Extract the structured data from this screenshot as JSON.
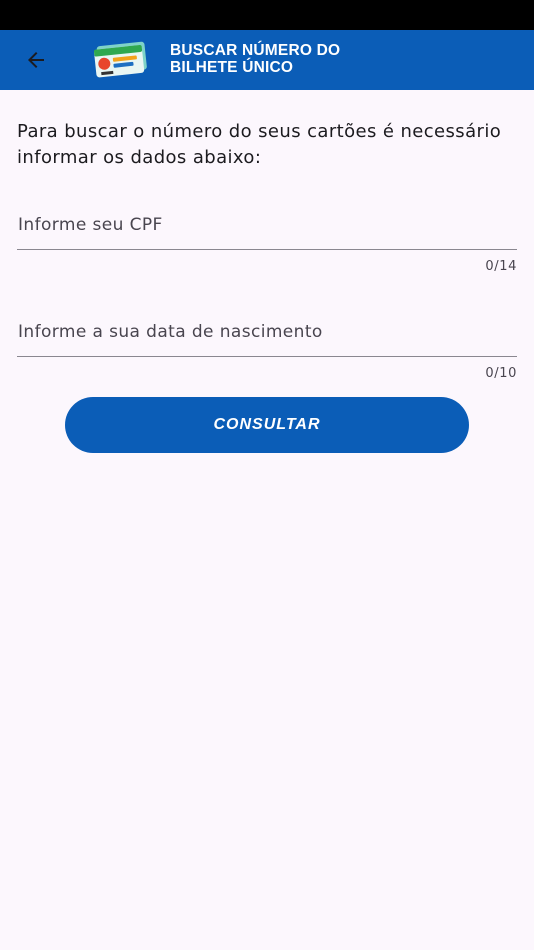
{
  "app_bar": {
    "title_line1": "BUSCAR NÚMERO DO",
    "title_line2": "BILHETE ÚNICO",
    "back_icon": "arrow-left-icon",
    "logo_text": "Bilhete Único"
  },
  "form": {
    "intro": "Para buscar o número do seus cartões é necessário informar os dados abaixo:",
    "cpf": {
      "value": "",
      "placeholder": "Informe seu CPF",
      "counter": "0/14"
    },
    "birth_date": {
      "value": "",
      "placeholder": "Informe a sua data de nascimento",
      "counter": "0/10"
    },
    "submit_label": "CONSULTAR"
  },
  "colors": {
    "primary": "#0B5DB7",
    "background": "#FCF7FD",
    "status_bar": "#000000"
  }
}
